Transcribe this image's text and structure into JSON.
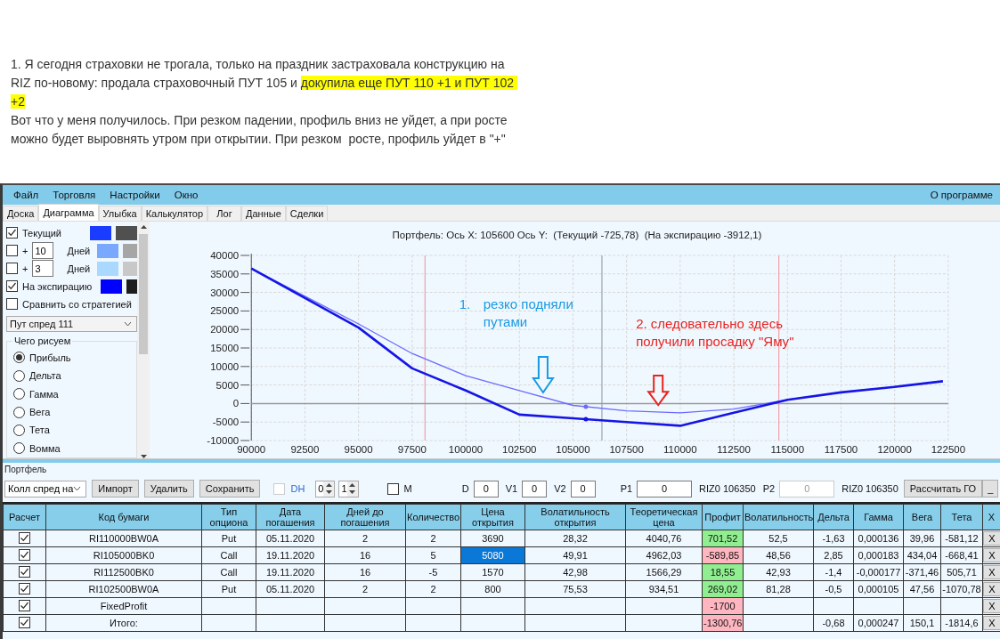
{
  "article": {
    "paragraphs": [
      {
        "segments": [
          {
            "text": "1. Я сегодня страховки не трогала, только на праздник застраховала конструкцию на RIZ по-новому: продала страховочный ПУТ 105 и ",
            "highlighted": false
          },
          {
            "text": "докупила еще ПУТ 110 +1 и ПУТ 102 +2",
            "highlighted": true
          }
        ]
      },
      {
        "segments": [
          {
            "text": "Вот что у меня получилось. При резком падении, профиль вниз не уйдет, а при росте можно будет выровнять утром при открытии. При резком  росте, профиль уйдет в \"+\"",
            "highlighted": false
          }
        ]
      }
    ]
  },
  "menu": {
    "items": [
      "Файл",
      "Торговля",
      "Настройки",
      "Окно"
    ],
    "about": "О программе"
  },
  "tabs": [
    {
      "label": "Доска",
      "selected": false
    },
    {
      "label": "Диаграмма",
      "selected": true
    },
    {
      "label": "Улыбка",
      "selected": false
    },
    {
      "label": "Калькулятор",
      "selected": false
    },
    {
      "label": "Лог",
      "selected": false
    },
    {
      "label": "Данные",
      "selected": false
    },
    {
      "label": "Сделки",
      "selected": false
    }
  ],
  "chart_options": {
    "series": [
      {
        "kind": "series",
        "label": "Текущий",
        "checked": true,
        "swatches": [
          {
            "color": "#1a3cff"
          },
          {
            "color": "#505050"
          }
        ]
      },
      {
        "kind": "days",
        "sign": "+",
        "value": "10",
        "unit": "Дней",
        "checked": false,
        "swatches": [
          {
            "color": "#7aa8ff"
          },
          {
            "color": "#a6a6a6"
          }
        ]
      },
      {
        "kind": "days",
        "sign": "+",
        "value": "3",
        "unit": "Дней",
        "checked": false,
        "swatches": [
          {
            "color": "#aad8ff"
          },
          {
            "color": "#c8c8c8"
          }
        ]
      },
      {
        "kind": "series",
        "label": "На экспирацию",
        "checked": true,
        "swatches": [
          {
            "color": "#0000ff"
          },
          {
            "color": "#1e1e1e"
          }
        ]
      }
    ],
    "compare": {
      "label": "Сравнить со стратегией",
      "checked": false
    },
    "strategy": "Пут спред 111",
    "plot_group": {
      "title": "Чего рисуем",
      "options": [
        {
          "label": "Прибыль",
          "selected": true
        },
        {
          "label": "Дельта",
          "selected": false
        },
        {
          "label": "Гамма",
          "selected": false
        },
        {
          "label": "Вега",
          "selected": false
        },
        {
          "label": "Тета",
          "selected": false
        },
        {
          "label": "Вомма",
          "selected": false
        }
      ]
    }
  },
  "chart": {
    "chart_data": {
      "type": "line",
      "title": "Портфель: Ось X: 105600 Ось Y:  (Текущий -725,78)  (На экспирацию -3912,1)",
      "x": [
        90000,
        92500,
        95000,
        97500,
        100000,
        102500,
        105000,
        107500,
        110000,
        112500,
        115000,
        117500,
        120000,
        122250
      ],
      "series": [
        {
          "color": "#6b6bff",
          "values": [
            36500,
            29000,
            21500,
            13500,
            7500,
            3500,
            -500,
            -2000,
            -2500,
            -1500,
            1000,
            3000,
            4500,
            6000
          ]
        },
        {
          "color": "#1515e6",
          "values": [
            36500,
            28500,
            20500,
            9500,
            3500,
            -3000,
            -4000,
            -5000,
            -6000,
            -2500,
            1000,
            3000,
            4500,
            6000
          ]
        }
      ],
      "xlim": [
        90000,
        122500
      ],
      "ylim": [
        -10000,
        40000
      ],
      "grid": true,
      "xticks": [
        90000,
        92500,
        95000,
        97500,
        100000,
        102500,
        105000,
        107500,
        110000,
        112500,
        115000,
        117500,
        120000,
        122500
      ],
      "yticks": [
        -10000,
        -5000,
        0,
        5000,
        10000,
        15000,
        20000,
        25000,
        30000,
        35000,
        40000
      ],
      "ref_lines": [
        {
          "axis": "x",
          "value": 98100,
          "color": "#f2a0a8"
        },
        {
          "axis": "x",
          "value": 106350,
          "color": "#9aa4b0"
        },
        {
          "axis": "x",
          "value": 114600,
          "color": "#f2a0a8"
        }
      ]
    },
    "notes": [
      {
        "number": "1.",
        "lines": [
          "резко подняли",
          "путами"
        ],
        "color": "#1a9ae0"
      },
      {
        "lines": [
          "2. следовательно здесь",
          "получили просадку \"Яму\""
        ],
        "color": "#e8231e"
      }
    ]
  },
  "portfolio": {
    "title": "Портфель",
    "toolbar": [
      {
        "kind": "select",
        "value": "Колл спред на"
      },
      {
        "kind": "button",
        "label": "Импорт"
      },
      {
        "kind": "button",
        "label": "Удалить"
      },
      {
        "kind": "button",
        "label": "Сохранить"
      },
      {
        "kind": "checkbox",
        "label": "DH",
        "checked": false,
        "disabled": true
      },
      {
        "kind": "spinner",
        "value": "0"
      },
      {
        "kind": "spinner",
        "value": "1"
      },
      {
        "kind": "checkbox",
        "label": "M",
        "checked": false,
        "disabled": false
      },
      {
        "kind": "field",
        "label": "D",
        "value": "0",
        "disabled": false
      },
      {
        "kind": "field",
        "label": "V1",
        "value": "0",
        "disabled": false
      },
      {
        "kind": "field",
        "label": "V2",
        "value": "0",
        "disabled": false
      },
      {
        "kind": "field",
        "label": "P1",
        "value": "0",
        "disabled": false
      },
      {
        "kind": "text",
        "label": "RIZ0 106350"
      },
      {
        "kind": "field",
        "label": "P2",
        "value": "0",
        "disabled": true
      },
      {
        "kind": "text",
        "label": "RIZ0 106350"
      },
      {
        "kind": "button",
        "label": "Рассчитать ГО"
      },
      {
        "kind": "minimize",
        "label": "_"
      }
    ],
    "table": {
      "columns": [
        "Расчет",
        "Код бумаги",
        "Тип опциона",
        "Дата погашения",
        "Дней до погашения",
        "Количество",
        "Цена открытия",
        "Волатильность открытия",
        "Теоретическая цена",
        "Профит",
        "Волатильность",
        "Дельта",
        "Гамма",
        "Вега",
        "Тета",
        "X"
      ],
      "rows": [
        {
          "checked": true,
          "code": "RI110000BW0A",
          "type": "Put",
          "expiry": "05.11.2020",
          "days": "2",
          "quantity": "2",
          "price": "3690",
          "selected": false,
          "open_vol": "28,32",
          "theo_price": "4040,76",
          "profit": "701,52",
          "color": "#90ee90",
          "volatility": "52,5",
          "delta": "-1,63",
          "gamma": "0,000136",
          "vega": "39,96",
          "theta": "-581,12",
          "remove": "X"
        },
        {
          "checked": true,
          "code": "RI105000BK0",
          "type": "Call",
          "expiry": "19.11.2020",
          "days": "16",
          "quantity": "5",
          "price": "5080",
          "selected": true,
          "open_vol": "49,91",
          "theo_price": "4962,03",
          "profit": "-589,85",
          "color": "#ffb6c1",
          "volatility": "48,56",
          "delta": "2,85",
          "gamma": "0,000183",
          "vega": "434,04",
          "theta": "-668,41",
          "remove": "X"
        },
        {
          "checked": true,
          "code": "RI112500BK0",
          "type": "Call",
          "expiry": "19.11.2020",
          "days": "16",
          "quantity": "-5",
          "price": "1570",
          "selected": false,
          "open_vol": "42,98",
          "theo_price": "1566,29",
          "profit": "18,55",
          "color": "#90ee90",
          "volatility": "42,93",
          "delta": "-1,4",
          "gamma": "-0,000177",
          "vega": "-371,46",
          "theta": "505,71",
          "remove": "X"
        },
        {
          "checked": true,
          "code": "RI102500BW0A",
          "type": "Put",
          "expiry": "05.11.2020",
          "days": "2",
          "quantity": "2",
          "price": "800",
          "selected": false,
          "open_vol": "75,53",
          "theo_price": "934,51",
          "profit": "269,02",
          "color": "#90ee90",
          "volatility": "81,28",
          "delta": "-0,5",
          "gamma": "0,000105",
          "vega": "47,56",
          "theta": "-1070,78",
          "remove": "X"
        },
        {
          "checked": true,
          "code": "FixedProfit",
          "selected": false,
          "profit": "-1700",
          "color": "#ffb6c1",
          "remove": "X"
        },
        {
          "checked": true,
          "code": "Итого:",
          "selected": false,
          "profit": "-1300,76",
          "color": "#ffb6c1",
          "delta": "-0,68",
          "gamma": "0,000247",
          "vega": "150,1",
          "theta": "-1814,6",
          "remove": "X"
        }
      ]
    }
  }
}
